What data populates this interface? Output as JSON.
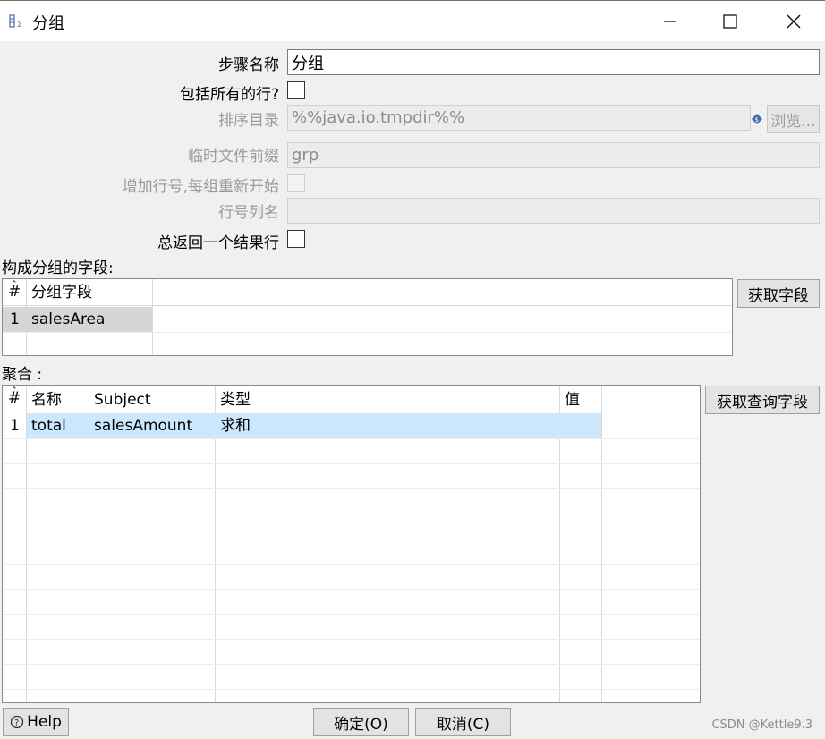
{
  "window": {
    "title": "分组",
    "icon": "group-step-icon"
  },
  "form": {
    "step_name_label": "步骤名称",
    "step_name_value": "分组",
    "include_all_rows_label": "包括所有的行?",
    "sort_dir_label": "排序目录",
    "sort_dir_value": "%%java.io.tmpdir%%",
    "browse_label": "浏览...",
    "temp_prefix_label": "临时文件前缀",
    "temp_prefix_value": "grp",
    "add_line_number_label": "增加行号,每组重新开始",
    "line_number_field_label": "行号列名",
    "line_number_field_value": "",
    "always_one_row_label": "总返回一个结果行"
  },
  "group_section": {
    "label": "构成分组的字段:",
    "columns": [
      "#",
      "分组字段"
    ],
    "rows": [
      [
        "1",
        "salesArea"
      ]
    ],
    "get_fields_label": "获取字段"
  },
  "agg_section": {
    "label": "聚合 :",
    "columns": [
      "#",
      "名称",
      "Subject",
      "类型",
      "值"
    ],
    "rows": [
      [
        "1",
        "total",
        "salesAmount",
        "求和",
        ""
      ]
    ],
    "get_lookup_fields_label": "获取查询字段"
  },
  "footer": {
    "help_label": "Help",
    "ok_label": "确定(O)",
    "cancel_label": "取消(C)",
    "watermark": "CSDN @Kettle9.3"
  }
}
